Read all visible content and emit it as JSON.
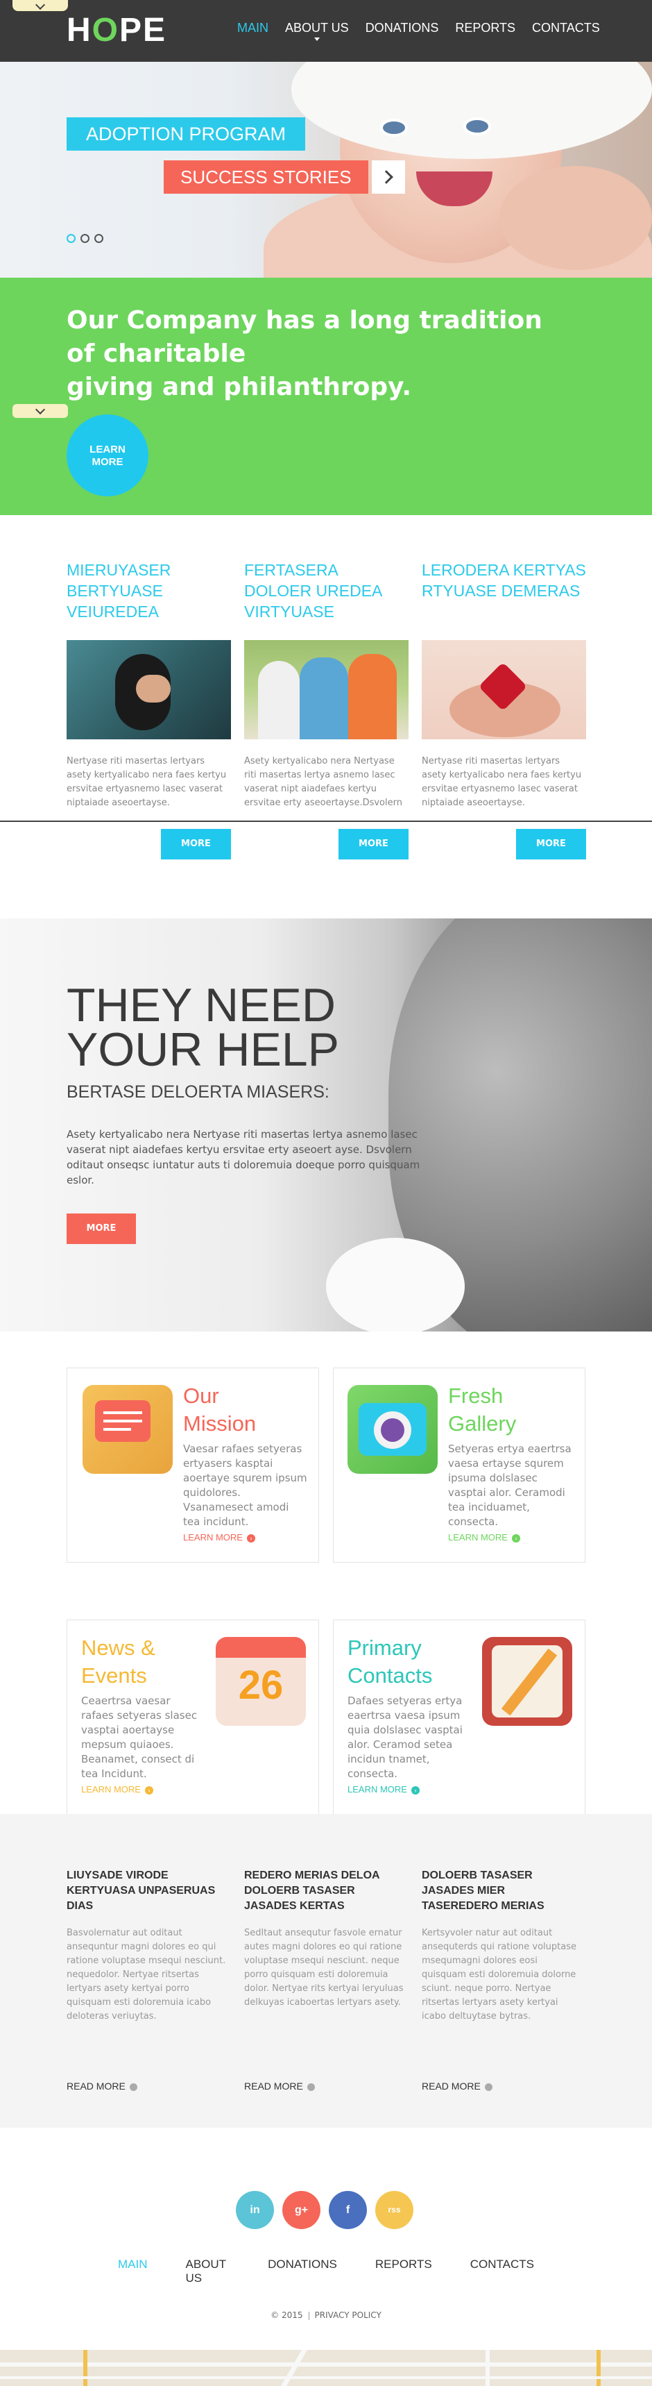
{
  "header": {
    "logo_pre": "H",
    "logo_o": "O",
    "logo_post": "PE",
    "nav": [
      "MAIN",
      "ABOUT US",
      "DONATIONS",
      "REPORTS",
      "CONTACTS"
    ],
    "active_nav": "MAIN",
    "accent": "#2ccaea"
  },
  "hero": {
    "title": "ADOPTION PROGRAM",
    "subtitle": "SUCCESS STORIES",
    "slides": 3,
    "active_slide": 1
  },
  "band": {
    "text_line1": "Our Company has a long tradition of charitable",
    "text_line2": "giving and philanthropy.",
    "button_line1": "LEARN",
    "button_line2": "MORE",
    "color": "#6dd55c"
  },
  "columns": [
    {
      "title": "MIERUYASER BERTYUASE VEIUREDEA",
      "text": "Nertyase riti masertas lertyars asety kertyalicabo nera faes kertyu ersvitae ertyasnemo lasec vaserat niptaiade aseoertayse.",
      "button": "MORE"
    },
    {
      "title": "FERTASERA DOLOER UREDEA VIRTYUASE",
      "text": "Asety kertyalicabo nera Nertyase riti masertas lertya asnemo lasec vaserat nipt aiadefaes kertyu ersvitae erty aseoertayse.Dsvolern",
      "button": "MORE"
    },
    {
      "title": "LERODERA KERTYAS RTYUASE DEMERAS",
      "text": "Nertyase riti masertas lertyars asety kertyalicabo nera faes kertyu ersvitae ertyasnemo lasec vaserat niptaiade aseoertayse.",
      "button": "MORE"
    }
  ],
  "help": {
    "title_line1": "THEY NEED",
    "title_line2": "YOUR HELP",
    "subtitle": "BERTASE DELOERTA MIASERS:",
    "text": "Asety kertyalicabo nera Nertyase riti masertas lertya asnemo lasec vaserat nipt aiadefaes kertyu ersvitae erty aseoert ayse. Dsvolern oditaut onseqsc iuntatur auts ti doloremuia doeque porro quisquam eslor.",
    "button": "MORE"
  },
  "boxes": [
    {
      "title_line1": "Our",
      "title_line2": "Mission",
      "text": "Vaesar rafaes setyeras ertyasers kasptai aoertaye squrem ipsum quidolores. Vsanamesect amodi tea incidunt.",
      "link": "LEARN MORE",
      "color": "#f56658"
    },
    {
      "title_line1": "Fresh",
      "title_line2": "Gallery",
      "text": "Setyeras ertya eaertrsa vaesa ertayse squrem ipsuma dolslasec vasptai alor. Ceramodi tea inciduamet, consecta.",
      "link": "LEARN MORE",
      "color": "#6dd55c"
    },
    {
      "title_line1": "News &",
      "title_line2": "Events",
      "text": "Ceaertrsa vaesar rafaes setyeras slasec vasptai aoertayse mepsum quiaoes. Beanamet, consect di tea Incidunt.",
      "link": "LEARN MORE",
      "color": "#f5b935",
      "calendar": "26"
    },
    {
      "title_line1": "Primary",
      "title_line2": "Contacts",
      "text": "Dafaes setyeras ertya eaertrsa vaesa ipsum quia dolslasec vasptai alor. Ceramod setea incidun tnamet, consecta.",
      "link": "LEARN MORE",
      "color": "#2cc6b8"
    }
  ],
  "news": [
    {
      "title": "LIUYSADE VIRODE KERTYUASA UNPASERUAS DIAS",
      "text": "Basvolernatur aut oditaut ansequntur magni dolores eo qui ratione voluptase msequi nesciunt. nequedolor. Nertyae ritsertas lertyars asety kertyai porro quisquam esti doloremuia icabo deloteras veriuytas.",
      "link": "READ MORE"
    },
    {
      "title": "REDERO MERIAS DELOA DOLOERB TASASER JASADES KERTAS",
      "text": "Sedltaut ansequtur fasvole ernatur autes magni dolores eo qui ratione voluptase msequi nesciunt. neque porro quisquam esti doloremuia dolor. Nertyae rits kertyai leryuluas delkuyas icaboertas lertyars asety.",
      "link": "READ MORE"
    },
    {
      "title": "DOLOERB TASASER JASADES MIER TASEREDERO MERIAS",
      "text": "Kertsyvoler natur aut oditaut ansequterds qui ratione voluptase msequmagni dolores eosi quisquam esti doloremuia dolorne sciunt. neque porro. Nertyae ritsertas lertyars asety kertyai icabo deltuytase bytras.",
      "link": "READ MORE"
    }
  ],
  "footer": {
    "social": [
      "in",
      "g+",
      "f",
      "rss"
    ],
    "social_colors": [
      "#5bc4d6",
      "#f56658",
      "#4a6fbf",
      "#f5c652"
    ],
    "nav": [
      "MAIN",
      "ABOUT US",
      "DONATIONS",
      "REPORTS",
      "CONTACTS"
    ],
    "year": "© 2015",
    "privacy": "PRIVACY POLICY"
  }
}
